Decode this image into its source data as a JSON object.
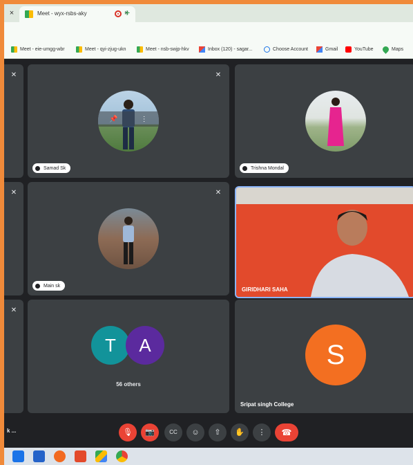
{
  "browser": {
    "prev_tab_close": "×",
    "tab_title": "Meet - wyx-rsbs-aky",
    "tab_close": "×",
    "new_tab": "+",
    "bookmarks": [
      {
        "label": "Meet - eie-umgg-wbr",
        "icon": "meet-icon"
      },
      {
        "label": "Meet - qyi-zjug-ukn",
        "icon": "meet-icon"
      },
      {
        "label": "Meet - nsb-swjp-hkv",
        "icon": "meet-icon"
      },
      {
        "label": "Inbox (120) - sagar...",
        "icon": "gmail-icon"
      },
      {
        "label": "Choose Account",
        "icon": "google-icon"
      },
      {
        "label": "Gmail",
        "icon": "gmail-icon"
      },
      {
        "label": "YouTube",
        "icon": "youtube-icon"
      },
      {
        "label": "Maps",
        "icon": "maps-icon"
      }
    ]
  },
  "meet": {
    "participants": [
      {
        "name": "Samad Sk"
      },
      {
        "name": "Trishna Mondal"
      },
      {
        "name": "Main sk"
      },
      {
        "name": "GIRIDHARI SAHA"
      },
      {
        "name": "Sripat singh College"
      }
    ],
    "others_bubbles": [
      "T",
      "A"
    ],
    "others_label": "56 others",
    "s_avatar_letter": "S",
    "left_label": "k ..."
  },
  "colors": {
    "accent_red": "#ea4335",
    "tile_bg": "#3c4043",
    "avatar_teal": "#12939a",
    "avatar_purple": "#5b2a9e",
    "avatar_orange": "#f36f21"
  }
}
